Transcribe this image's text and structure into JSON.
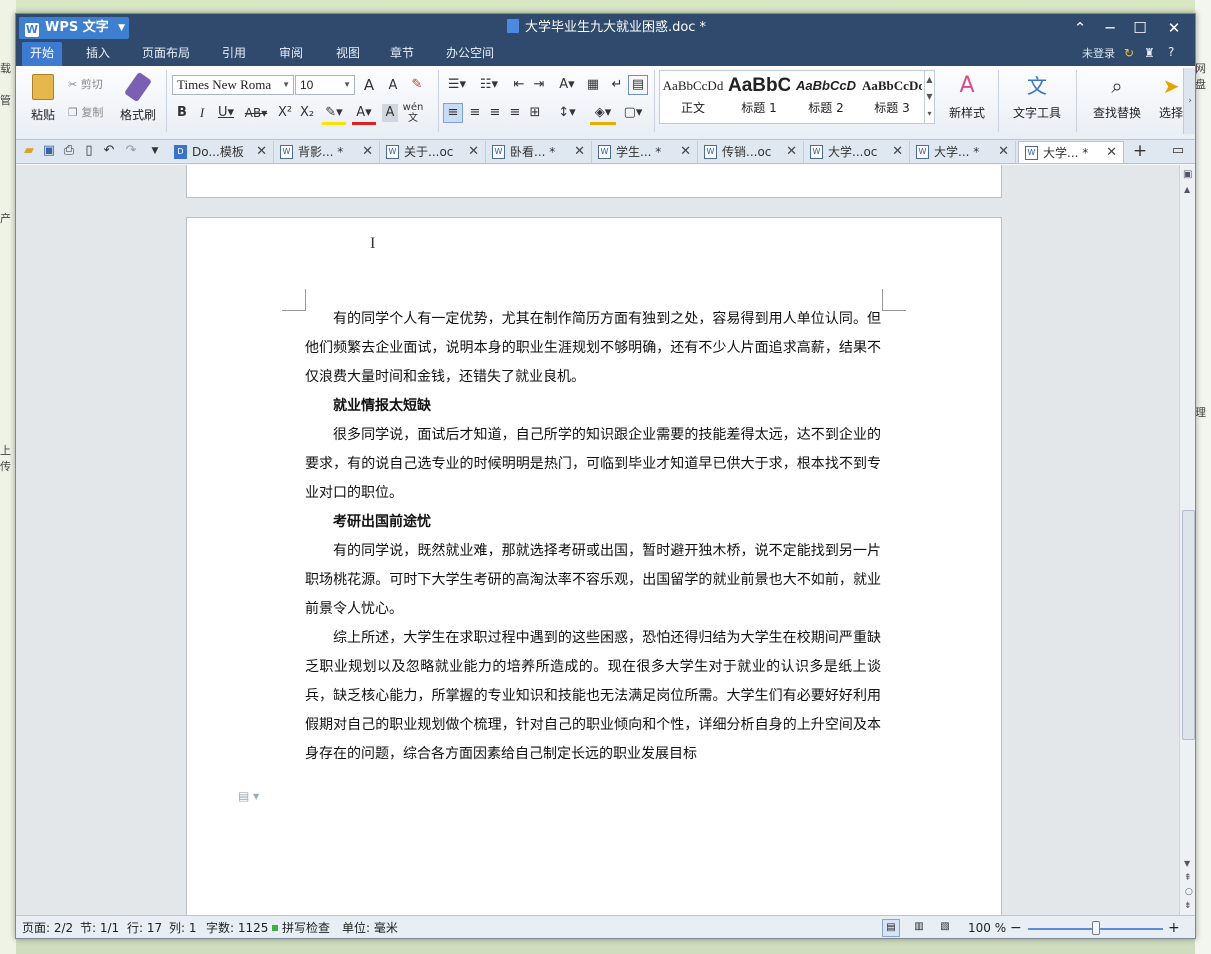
{
  "titlebar": {
    "app_button": "WPS 文字",
    "document_title": "大学毕业生九大就业困惑.doc *",
    "controls": {
      "up": "⌃",
      "minimize": "─",
      "maximize": "☐",
      "close": "✕"
    }
  },
  "menu": {
    "tabs": [
      "开始",
      "插入",
      "页面布局",
      "引用",
      "审阅",
      "视图",
      "章节",
      "办公空间"
    ],
    "active_tab": "开始",
    "login_text": "未登录",
    "help": "?"
  },
  "ribbon": {
    "paste": "粘贴",
    "cut": "剪切",
    "copy": "复制",
    "format_painter": "格式刷",
    "font_name": "Times New Roma",
    "font_size": "10",
    "styles": [
      {
        "preview": "AaBbCcDd",
        "name": "正文"
      },
      {
        "preview": "AaBbC",
        "name": "标题 1"
      },
      {
        "preview": "AaBbCcD",
        "name": "标题 2"
      },
      {
        "preview": "AaBbCcDc",
        "name": "标题 3"
      }
    ],
    "new_style": "新样式",
    "text_tools": "文字工具",
    "find_replace": "查找替换",
    "select": "选择"
  },
  "doc_tabs": [
    {
      "label": "Do...模板",
      "icon": "D"
    },
    {
      "label": "背影... *",
      "icon": "W"
    },
    {
      "label": "关于...oc",
      "icon": "W"
    },
    {
      "label": "卧看... *",
      "icon": "W"
    },
    {
      "label": "学生... *",
      "icon": "W"
    },
    {
      "label": "传销...oc",
      "icon": "W"
    },
    {
      "label": "大学...oc",
      "icon": "W"
    },
    {
      "label": "大学... *",
      "icon": "W"
    },
    {
      "label": "大学... *",
      "icon": "W"
    }
  ],
  "document": {
    "paragraphs": [
      {
        "type": "body",
        "text": "有的同学个人有一定优势，尤其在制作简历方面有独到之处，容易得到用人单位认同。但他们频繁去企业面试，说明本身的职业生涯规划不够明确，还有不少人片面追求高薪，结果不仅浪费大量时间和金钱，还错失了就业良机。"
      },
      {
        "type": "heading",
        "text": "就业情报太短缺"
      },
      {
        "type": "body",
        "text": "很多同学说，面试后才知道，自己所学的知识跟企业需要的技能差得太远，达不到企业的要求，有的说自己选专业的时候明明是热门，可临到毕业才知道早已供大于求，根本找不到专业对口的职位。"
      },
      {
        "type": "heading",
        "text": "考研出国前途忧"
      },
      {
        "type": "body",
        "text": "有的同学说，既然就业难，那就选择考研或出国，暂时避开独木桥，说不定能找到另一片职场桃花源。可时下大学生考研的高淘汰率不容乐观，出国留学的就业前景也大不如前，就业前景令人忧心。"
      },
      {
        "type": "body",
        "text": "综上所述，大学生在求职过程中遇到的这些困惑，恐怕还得归结为大学生在校期间严重缺乏职业规划以及忽略就业能力的培养所造成的。现在很多大学生对于就业的认识多是纸上谈兵，缺乏核心能力，所掌握的专业知识和技能也无法满足岗位所需。大学生们有必要好好利用假期对自己的职业规划做个梳理，针对自己的职业倾向和个性，详细分析自身的上升空间及本身存在的问题，综合各方面因素给自己制定长远的职业发展目标"
      }
    ]
  },
  "status": {
    "page": "页面: 2/2",
    "section": "节: 1/1",
    "row": "行: 17",
    "col": "列: 1",
    "words": "字数: 1125",
    "spell": "拼写检查",
    "unit": "单位: 毫米",
    "zoom": "100 %",
    "zoom_fraction": 0.5
  },
  "background_window": {
    "left_fragments": [
      "载",
      "管",
      "产",
      "上传"
    ],
    "right_fragments": [
      "网盘",
      "理"
    ]
  }
}
